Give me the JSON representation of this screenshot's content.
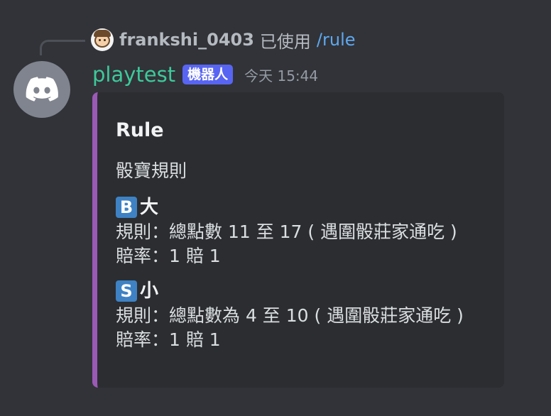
{
  "reply": {
    "username": "frankshi_0403",
    "used_text": "已使用",
    "command": "/rule"
  },
  "message": {
    "username": "playtest",
    "badge": "機器人",
    "timestamp": "今天 15:44"
  },
  "embed": {
    "accent_color": "#9b59b6",
    "title": "Rule",
    "description": "骰寶規則",
    "fields": [
      {
        "icon_letter": "B",
        "icon_name": "regional-indicator-b-icon",
        "name": "大",
        "rule": "規則：總點數 11 至 17 ( 遇圍骰莊家通吃 )",
        "odds": "賠率：1 賠 1"
      },
      {
        "icon_letter": "S",
        "icon_name": "regional-indicator-s-icon",
        "name": "小",
        "rule": "規則：總點數為 4 至 10 ( 遇圍骰莊家通吃 )",
        "odds": "賠率：1 賠 1"
      }
    ]
  },
  "colors": {
    "background": "#313338",
    "embed_background": "#2b2d31",
    "username": "#3ec99a",
    "badge": "#5865f2",
    "command": "#5fa8ef",
    "letter_icon": "#3e82c4"
  }
}
